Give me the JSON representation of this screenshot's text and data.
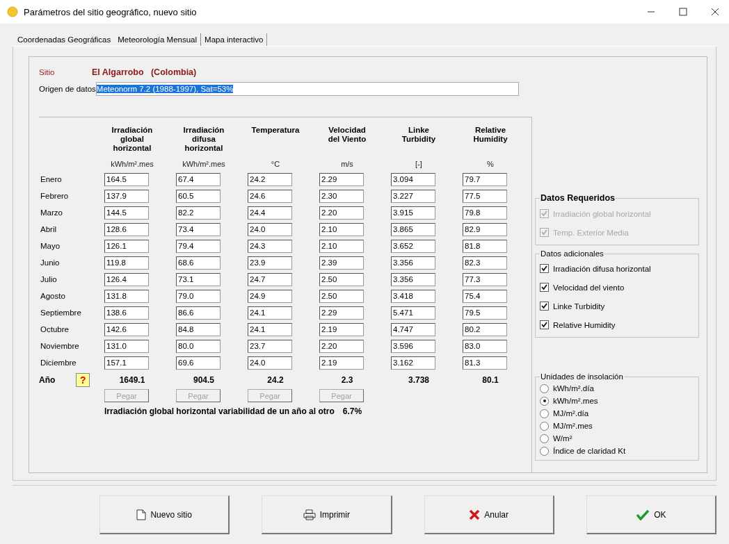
{
  "window": {
    "title": "Parámetros del sitio geográfico, nuevo sitio"
  },
  "tabs": [
    {
      "label": "Coordenadas Geográficas",
      "selected": false
    },
    {
      "label": "Meteorología Mensual",
      "selected": true
    },
    {
      "label": "Mapa interactivo",
      "selected": false
    }
  ],
  "site": {
    "label": "Sitio",
    "name": "El Algarrobo   (Colombia)"
  },
  "origin": {
    "label": "Origen de datos",
    "value": "Meteonorm 7.2 (1988-1997), Sat=53%",
    "selected": true
  },
  "columns": [
    {
      "title": "Irradiación\nglobal\nhorizontal",
      "unit": "kWh/m².mes"
    },
    {
      "title": "Irradiación\ndifusa\nhorizontal",
      "unit": "kWh/m².mes"
    },
    {
      "title": "Temperatura",
      "unit": "°C"
    },
    {
      "title": "Velocidad\ndel Viento",
      "unit": "m/s"
    },
    {
      "title": "Linke\nTurbidity",
      "unit": "[-]"
    },
    {
      "title": "Relative\nHumidity",
      "unit": "%"
    }
  ],
  "months": [
    {
      "name": "Enero",
      "values": [
        "164.5",
        "67.4",
        "24.2",
        "2.29",
        "3.094",
        "79.7"
      ]
    },
    {
      "name": "Febrero",
      "values": [
        "137.9",
        "60.5",
        "24.6",
        "2.30",
        "3.227",
        "77.5"
      ]
    },
    {
      "name": "Marzo",
      "values": [
        "144.5",
        "82.2",
        "24.4",
        "2.20",
        "3.915",
        "79.8"
      ]
    },
    {
      "name": "Abril",
      "values": [
        "128.6",
        "73.4",
        "24.0",
        "2.10",
        "3.865",
        "82.9"
      ]
    },
    {
      "name": "Mayo",
      "values": [
        "126.1",
        "79.4",
        "24.3",
        "2.10",
        "3.652",
        "81.8"
      ]
    },
    {
      "name": "Junio",
      "values": [
        "119.8",
        "68.6",
        "23.9",
        "2.39",
        "3.356",
        "82.3"
      ]
    },
    {
      "name": "Julio",
      "values": [
        "126.4",
        "73.1",
        "24.7",
        "2.50",
        "3.356",
        "77.3"
      ]
    },
    {
      "name": "Agosto",
      "values": [
        "131.8",
        "79.0",
        "24.9",
        "2.50",
        "3.418",
        "75.4"
      ]
    },
    {
      "name": "Septiembre",
      "values": [
        "138.6",
        "86.6",
        "24.1",
        "2.29",
        "5.471",
        "79.5"
      ]
    },
    {
      "name": "Octubre",
      "values": [
        "142.6",
        "84.8",
        "24.1",
        "2.19",
        "4.747",
        "80.2"
      ]
    },
    {
      "name": "Noviembre",
      "values": [
        "131.0",
        "80.0",
        "23.7",
        "2.20",
        "3.596",
        "83.0"
      ]
    },
    {
      "name": "Diciembre",
      "values": [
        "157.1",
        "69.6",
        "24.0",
        "2.19",
        "3.162",
        "81.3"
      ]
    }
  ],
  "year": {
    "label": "Año",
    "help": "?",
    "values": [
      "1649.1",
      "904.5",
      "24.2",
      "2.3",
      "3.738",
      "80.1"
    ]
  },
  "paste_buttons": [
    {
      "label": "Pegar",
      "disabled": true
    },
    {
      "label": "Pegar",
      "disabled": true
    },
    {
      "label": "Pegar",
      "disabled": true
    },
    {
      "label": "Pegar",
      "disabled": true
    }
  ],
  "variability": {
    "label": "Irradiación global horizontal variabilidad de un año al otro",
    "value": "6.7%"
  },
  "required": {
    "title": "Datos Requeridos",
    "items": [
      {
        "label": "Irradiación global horizontal",
        "checked": true,
        "disabled": true
      },
      {
        "label": "Temp. Exterior Media",
        "checked": true,
        "disabled": true
      }
    ]
  },
  "additional": {
    "title": "Datos adicionales",
    "items": [
      {
        "label": "Irradiación difusa horizontal",
        "checked": true,
        "disabled": false
      },
      {
        "label": "Velocidad del viento",
        "checked": true,
        "disabled": false
      },
      {
        "label": "Linke Turbidity",
        "checked": true,
        "disabled": false
      },
      {
        "label": "Relative Humidity",
        "checked": true,
        "disabled": false
      }
    ]
  },
  "units": {
    "title": "Unidades de insolación",
    "options": [
      {
        "label": "kWh/m².día",
        "selected": false
      },
      {
        "label": "kWh/m².mes",
        "selected": true
      },
      {
        "label": "MJ/m².día",
        "selected": false
      },
      {
        "label": "MJ/m².mes",
        "selected": false
      },
      {
        "label": "W/m²",
        "selected": false
      },
      {
        "label": "Índice de claridad Kt",
        "selected": false
      }
    ]
  },
  "buttons": [
    {
      "label": "Nuevo sitio",
      "kind": "new"
    },
    {
      "label": "Imprimir",
      "kind": "print"
    },
    {
      "label": "Anular",
      "kind": "cancel"
    },
    {
      "label": "OK",
      "kind": "ok"
    }
  ]
}
